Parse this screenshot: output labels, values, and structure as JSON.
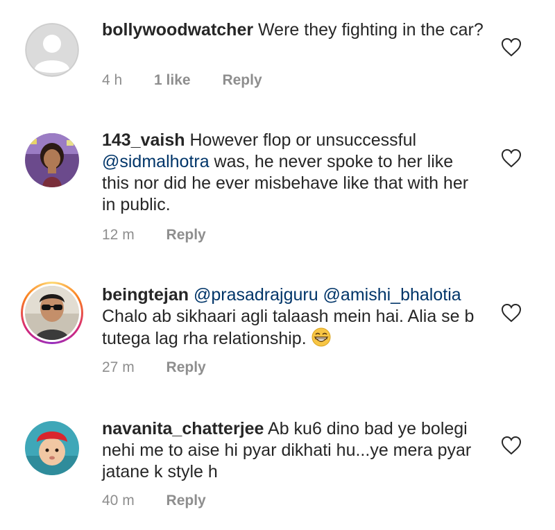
{
  "comments": [
    {
      "username": "bollywoodwatcher",
      "text_before": " Were they fighting in the car?",
      "mention": "",
      "text_after": "",
      "time": "4 h",
      "likes": "1 like",
      "reply": "Reply"
    },
    {
      "username": "143_vaish",
      "text_before": " However flop or unsuccessful ",
      "mention": "@sidmalhotra",
      "text_after": " was, he never spoke to her like this nor did he ever misbehave like that with her in public.",
      "time": "12 m",
      "likes": "",
      "reply": "Reply"
    },
    {
      "username": "beingtejan",
      "text_before": " ",
      "mention": "@prasadrajguru @amishi_bhalotia",
      "text_after": " Chalo ab sikhaari agli talaash mein hai. Alia se b tutega lag rha relationship. ",
      "emoji": "grinning-face-emoji",
      "time": "27 m",
      "likes": "",
      "reply": "Reply"
    },
    {
      "username": "navanita_chatterjee",
      "text_before": " Ab ku6 dino bad ye bolegi nehi me to aise hi pyar dikhati hu...ye mera pyar jatane k style h",
      "mention": "",
      "text_after": "",
      "time": "40 m",
      "likes": "",
      "reply": "Reply"
    }
  ],
  "colors": {
    "text": "#262626",
    "meta": "#8e8e8e",
    "mention": "#003569"
  }
}
